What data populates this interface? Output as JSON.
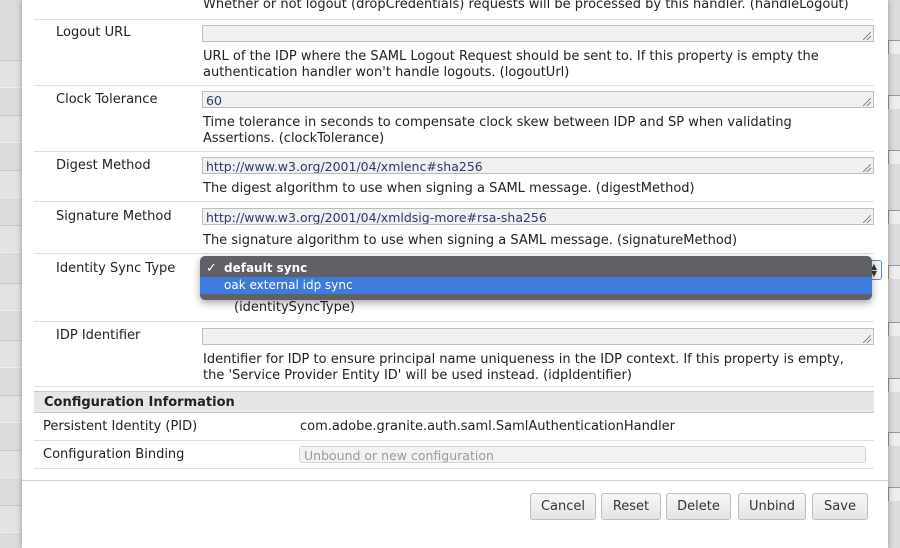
{
  "properties": {
    "handle_logout_desc": "Whether or not logout (dropCredentials) requests will be processed by this handler. (handleLogout)",
    "logout_url": {
      "label": "Logout URL",
      "value": "",
      "desc": "URL of the IDP where the SAML Logout Request should be sent to. If this property is empty the authentication handler won't handle logouts. (logoutUrl)"
    },
    "clock_tolerance": {
      "label": "Clock Tolerance",
      "value": "60",
      "desc": "Time tolerance in seconds to compensate clock skew between IDP and SP when validating Assertions. (clockTolerance)"
    },
    "digest_method": {
      "label": "Digest Method",
      "value": "http://www.w3.org/2001/04/xmlenc#sha256",
      "desc": "The digest algorithm to use when signing a SAML message. (digestMethod)"
    },
    "signature_method": {
      "label": "Signature Method",
      "value": "http://www.w3.org/2001/04/xmldsig-more#rsa-sha256",
      "desc": "The signature algorithm to use when signing a SAML message. (signatureMethod)"
    },
    "identity_sync_type": {
      "label": "Identity Sync Type",
      "options": [
        "default sync",
        "oak external idp sync"
      ],
      "selected": "default sync",
      "desc_partial": "(identitySyncType)"
    },
    "idp_identifier": {
      "label": "IDP Identifier",
      "value": "",
      "desc": "Identifier for IDP to ensure principal name uniqueness in the IDP context. If this property is empty, the 'Service Provider Entity ID' will be used instead. (idpIdentifier)"
    }
  },
  "config_info": {
    "header": "Configuration Information",
    "pid_label": "Persistent Identity (PID)",
    "pid_value": "com.adobe.granite.auth.saml.SamlAuthenticationHandler",
    "binding_label": "Configuration Binding",
    "binding_placeholder": "Unbound or new configuration"
  },
  "buttons": {
    "cancel": "Cancel",
    "reset": "Reset",
    "delete": "Delete",
    "unbind": "Unbind",
    "save": "Save"
  },
  "colors": {
    "dropdown_bg": "#5f6166",
    "dropdown_highlight": "#3d7bdc",
    "focus_border": "#5a8fd8"
  }
}
